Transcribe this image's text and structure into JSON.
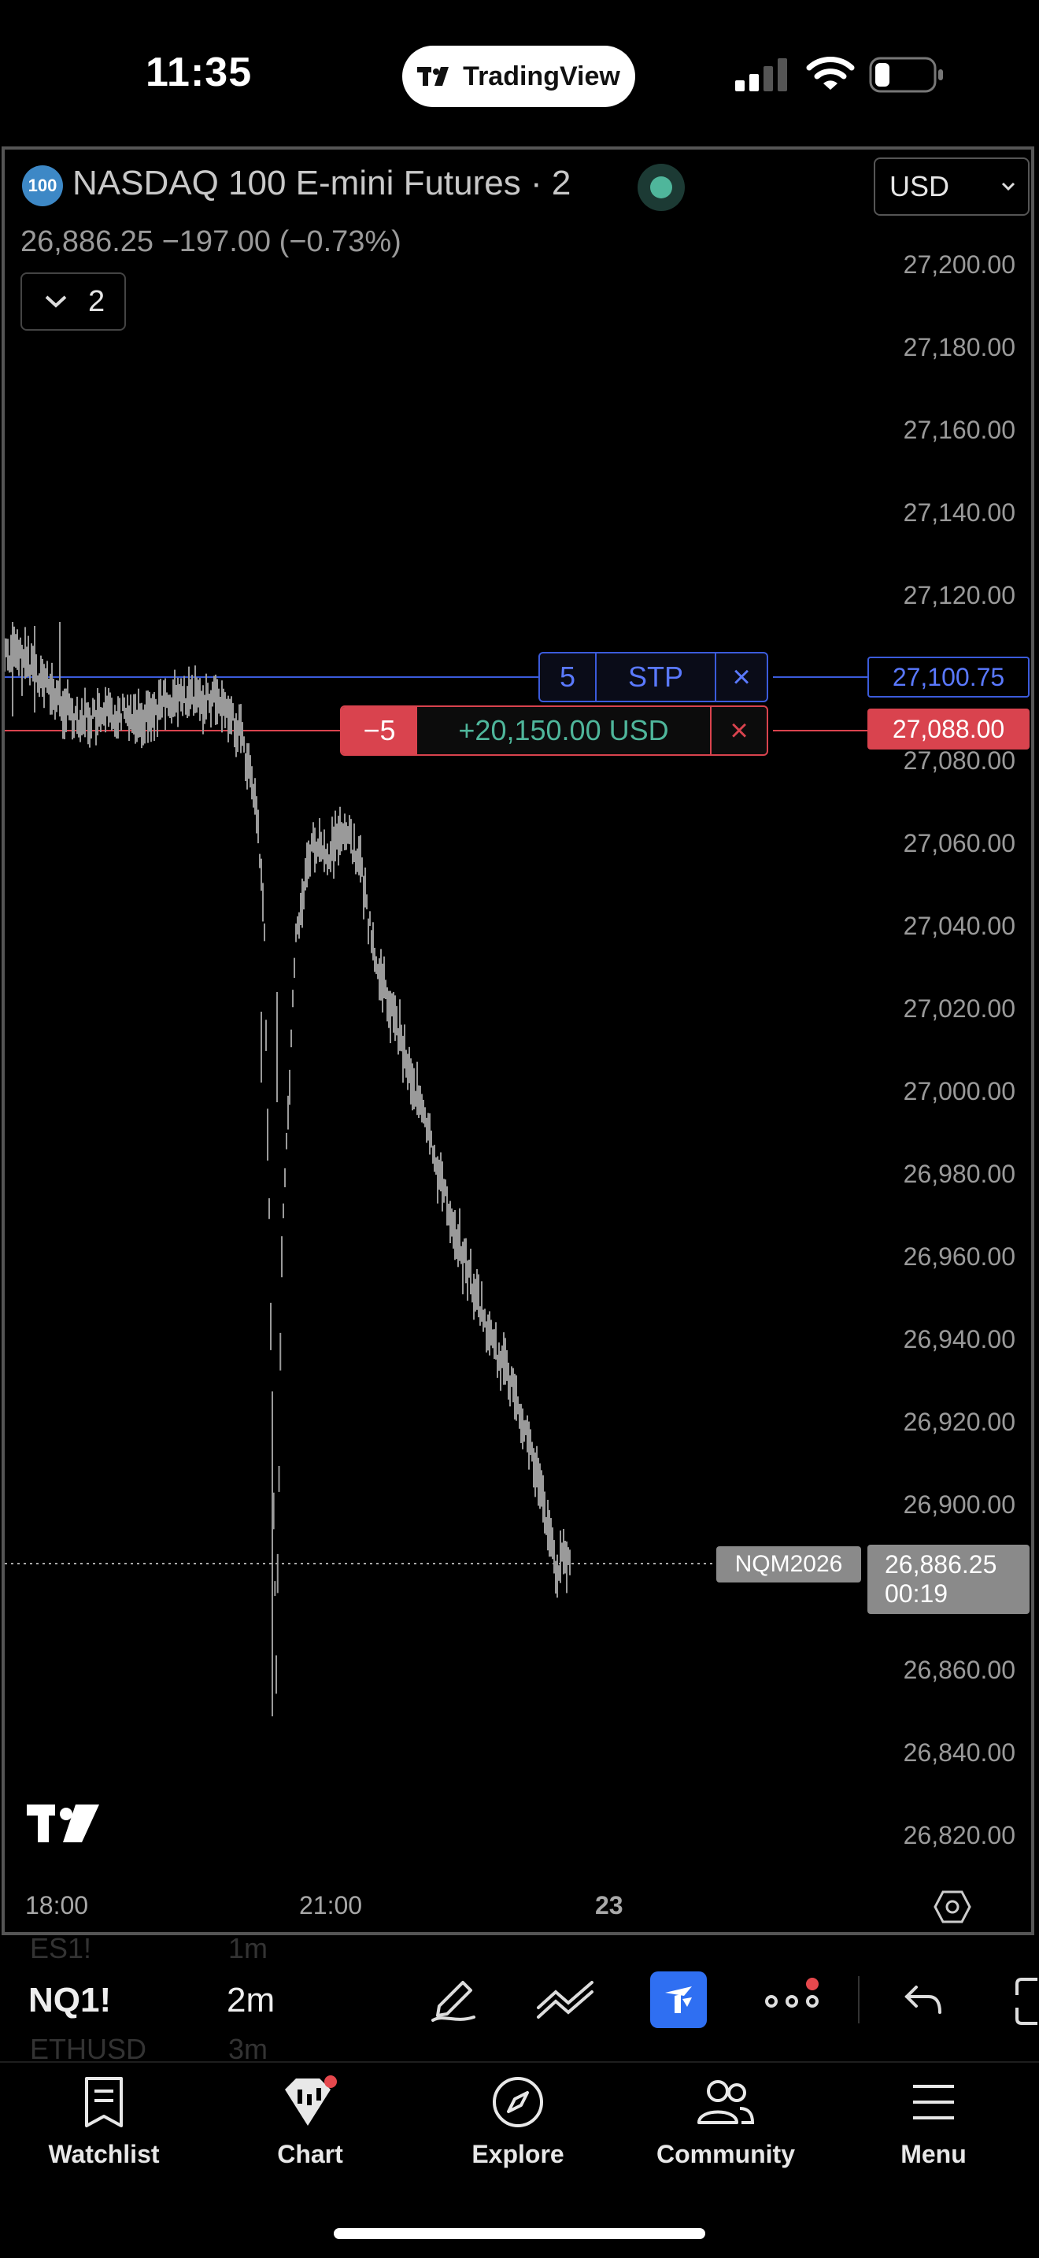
{
  "status_bar": {
    "time": "11:35",
    "app_pill_label": "TradingView"
  },
  "chart_header": {
    "symbol_badge": "100",
    "title": "NASDAQ 100 E-mini Futures · 2",
    "quote": "26,886.25  −197.00 (−0.73%)",
    "currency": "USD",
    "indicator_count": "2"
  },
  "price_axis": {
    "labels": [
      "27,200.00",
      "27,180.00",
      "27,160.00",
      "27,140.00",
      "27,120.00",
      "27,080.00",
      "27,060.00",
      "27,040.00",
      "27,020.00",
      "27,000.00",
      "26,980.00",
      "26,960.00",
      "26,940.00",
      "26,920.00",
      "26,900.00",
      "26,860.00",
      "26,840.00",
      "26,820.00"
    ],
    "stop_price": "27,100.75",
    "position_price": "27,088.00",
    "last_price": "26,886.25",
    "countdown": "00:19",
    "contract": "NQM2026"
  },
  "time_axis": {
    "labels": [
      "18:00",
      "21:00",
      "23"
    ]
  },
  "orders": {
    "stop": {
      "qty": "5",
      "type": "STP",
      "close": "×"
    },
    "position": {
      "qty": "−5",
      "pnl": "+20,150.00 USD",
      "close": "×"
    }
  },
  "toolbar": {
    "symbol": "NQ1!",
    "interval": "2m",
    "ghost_above_symbol": "ES1!",
    "ghost_above_interval": "1m",
    "ghost_below_symbol": "ETHUSD",
    "ghost_below_interval": "3m"
  },
  "tabs": [
    {
      "label": "Watchlist"
    },
    {
      "label": "Chart"
    },
    {
      "label": "Explore"
    },
    {
      "label": "Community"
    },
    {
      "label": "Menu"
    }
  ],
  "colors": {
    "stop_line": "#3b5bdb",
    "position_line": "#d9434e",
    "profit": "#4fb69b",
    "active_tool": "#2f6ff2"
  }
}
